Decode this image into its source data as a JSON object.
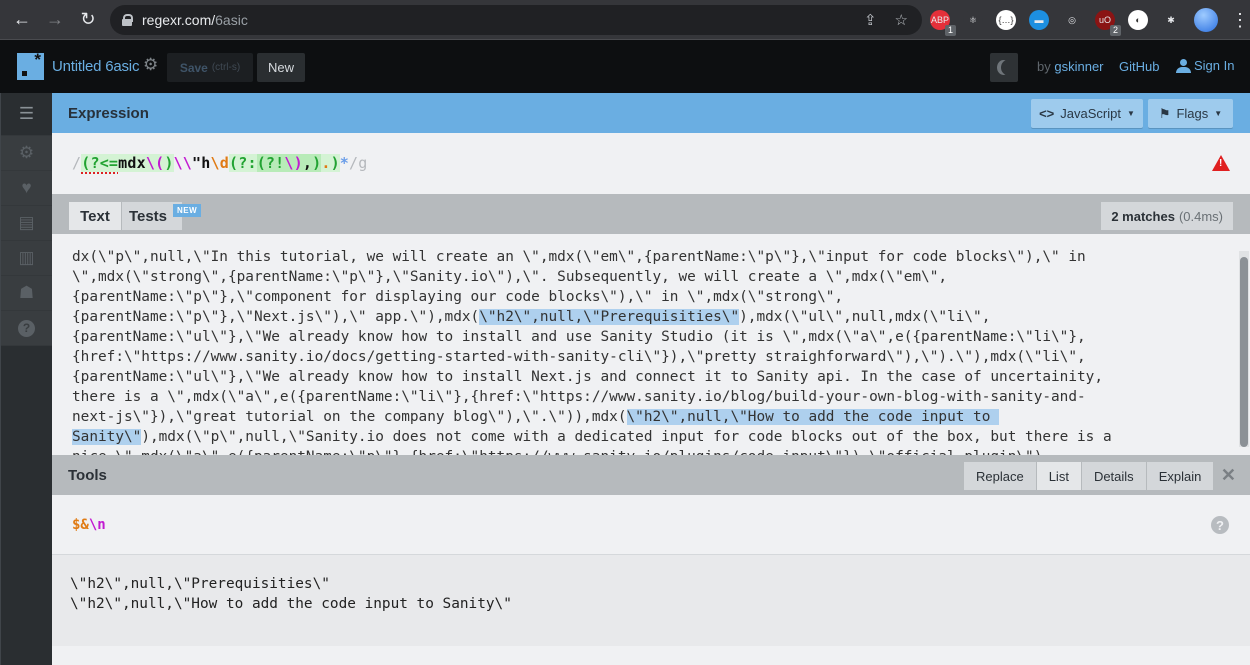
{
  "browser": {
    "url_host": "regexr.com/",
    "url_path": "6asic",
    "extensions": [
      {
        "name": "adblock",
        "label": "ABP",
        "badge": "1",
        "color": "#e4303a"
      },
      {
        "name": "react-devtools",
        "label": "⚛",
        "badge": "",
        "color": "#35363a"
      },
      {
        "name": "json-viewer",
        "label": "{…}",
        "badge": "",
        "color": "#ffffff"
      },
      {
        "name": "window-ext",
        "label": "▬",
        "badge": "",
        "color": "#1d8fe0"
      },
      {
        "name": "target-ext",
        "label": "◎",
        "badge": "",
        "color": "#35363a"
      },
      {
        "name": "ublock",
        "label": "uO",
        "badge": "2",
        "color": "#8a1414"
      },
      {
        "name": "color-ext",
        "label": "◐",
        "badge": "",
        "color": "#ffffff"
      },
      {
        "name": "extensions-puzzle",
        "label": "✱",
        "badge": "",
        "color": "#35363a"
      }
    ]
  },
  "header": {
    "title": "Untitled 6asic",
    "save_label": "Save",
    "save_hint": "(ctrl-s)",
    "new_label": "New",
    "by_label": "by",
    "author": "gskinner",
    "github_label": "GitHub",
    "signin_label": "Sign In"
  },
  "sidebar": {
    "items": [
      {
        "name": "menu",
        "icon": "☰"
      },
      {
        "name": "settings",
        "icon": "⚙"
      },
      {
        "name": "favorites",
        "icon": "♥"
      },
      {
        "name": "cheatsheet",
        "icon": "▤"
      },
      {
        "name": "reference",
        "icon": "▥"
      },
      {
        "name": "community",
        "icon": "☗"
      },
      {
        "name": "help",
        "icon": "?"
      }
    ]
  },
  "expression": {
    "section_title": "Expression",
    "language_label": "JavaScript",
    "flags_label": "Flags",
    "open_delim": "/",
    "parts": {
      "lookbehind_open": "(?<=",
      "literal_mdx": "mdx",
      "esc_paren": "\\(",
      "close_paren": ")",
      "esc_backslash": "\\\\",
      "literal_quote_h": "\"h",
      "esc_digit": "\\d",
      "noncap_open": "(?:",
      "lookahead_open": "(?!",
      "esc_close_paren": "\\)",
      "comma": ",",
      "lookahead_close": ")",
      "dot": ".",
      "noncap_close": ")",
      "quantifier": "*"
    },
    "close_delim": "/",
    "flags": "g",
    "full": "/(?<=mdx\\()\\\\\"h\\d(?:(?!\\),).)*/g"
  },
  "text_panel": {
    "tab_text": "Text",
    "tab_tests": "Tests",
    "tests_badge": "NEW",
    "match_count": "2 matches",
    "match_time": "(0.4ms)",
    "lines": [
      [
        "dx(\\\"p\\\",null,\\\"In this tutorial, we will create an \\\",mdx(\\\"em\\\",{parentName:\\\"p\\\"},\\\"input for code blocks\\\"),\\\" in "
      ],
      [
        "\\\",mdx(\\\"strong\\\",{parentName:\\\"p\\\"},\\\"Sanity.io\\\"),\\\". Subsequently, we will create a \\\",mdx(\\\"em\\\","
      ],
      [
        "{parentName:\\\"p\\\"},\\\"component for displaying our code blocks\\\"),\\\" in \\\",mdx(\\\"strong\\\","
      ],
      [
        "{parentName:\\\"p\\\"},\\\"Next.js\\\"),\\\" app.\\\"),mdx(",
        {
          "hl": "\\\"h2\\\",null,\\\"Prerequisities\\\""
        },
        "),mdx(\\\"ul\\\",null,mdx(\\\"li\\\","
      ],
      [
        "{parentName:\\\"ul\\\"},\\\"We already know how to install and use Sanity Studio (it is \\\",mdx(\\\"a\\\",e({parentName:\\\"li\\\"},"
      ],
      [
        "{href:\\\"https://www.sanity.io/docs/getting-started-with-sanity-cli\\\"}),\\\"pretty straighforward\\\"),\\\").\\\"),mdx(\\\"li\\\","
      ],
      [
        "{parentName:\\\"ul\\\"},\\\"We already know how to install Next.js and connect it to Sanity api. In the case of uncertainity, "
      ],
      [
        "there is a \\\",mdx(\\\"a\\\",e({parentName:\\\"li\\\"},{href:\\\"https://www.sanity.io/blog/build-your-own-blog-with-sanity-and-"
      ],
      [
        "next-js\\\"}),\\\"great tutorial on the company blog\\\"),\\\".\\\")),mdx(",
        {
          "hl": "\\\"h2\\\",null,\\\"How to add the code input to "
        }
      ],
      [
        {
          "hl": "Sanity\\\""
        },
        "),mdx(\\\"p\\\",null,\\\"Sanity.io does not come with a dedicated input for code blocks out of the box, but there is a "
      ],
      [
        "nice \\\",mdx(\\\"a\\\",e({parentName:\\\"p\\\"},{href:\\\"https://www.sanity.io/plugins/code-input\\\"}),\\\"official plugin\\\"),"
      ]
    ]
  },
  "tools": {
    "section_title": "Tools",
    "tabs": [
      "Replace",
      "List",
      "Details",
      "Explain"
    ],
    "active_tab": "List",
    "substitution_token": "$&",
    "substitution_escape": "\\n",
    "output_lines": [
      "\\\"h2\\\",null,\\\"Prerequisities\\\"",
      "\\\"h2\\\",null,\\\"How to add the code input to Sanity\\\""
    ]
  }
}
